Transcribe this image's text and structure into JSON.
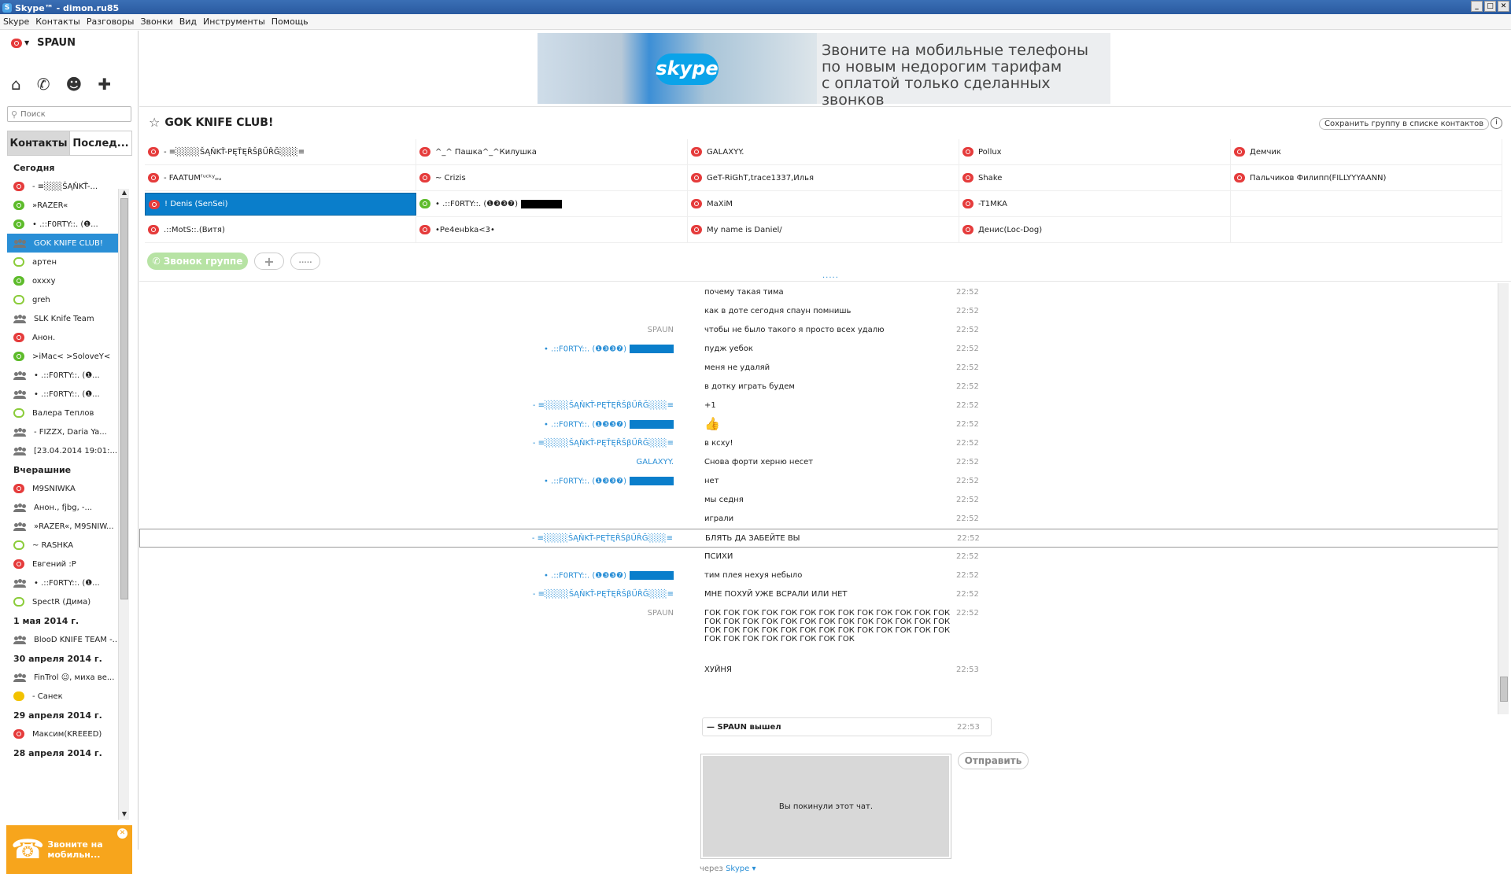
{
  "window": {
    "title": "Skype™ - dimon.ru85"
  },
  "menu": [
    "Skype",
    "Контакты",
    "Разговоры",
    "Звонки",
    "Вид",
    "Инструменты",
    "Помощь"
  ],
  "profile": {
    "name": "SPAUN"
  },
  "search": {
    "placeholder": "Поиск"
  },
  "tabs": [
    "Контакты",
    "Послед..."
  ],
  "recent": [
    {
      "type": "section",
      "label": "Сегодня"
    },
    {
      "type": "item",
      "label": "-        ≡░░░ŠĄŇKŤ-...",
      "status": "red"
    },
    {
      "type": "item",
      "label": "»RAZER«",
      "status": "green"
    },
    {
      "type": "item",
      "label": "• .::F0RTY::.  (❶...",
      "status": "green"
    },
    {
      "type": "item",
      "label": "GOK KNIFE CLUB!",
      "status": "grp",
      "selected": true
    },
    {
      "type": "item",
      "label": "артен",
      "status": "ring"
    },
    {
      "type": "item",
      "label": "oxxxy",
      "status": "green"
    },
    {
      "type": "item",
      "label": "greh",
      "status": "ring"
    },
    {
      "type": "item",
      "label": "SLK Knife Team",
      "status": "grp"
    },
    {
      "type": "item",
      "label": "Анон.",
      "status": "red"
    },
    {
      "type": "item",
      "label": ">iMac< >SoloveY<",
      "status": "green"
    },
    {
      "type": "item",
      "label": "• .::F0RTY::.  (❶...",
      "status": "grp"
    },
    {
      "type": "item",
      "label": "• .::F0RTY::.  (❶...",
      "status": "grp"
    },
    {
      "type": "item",
      "label": "Валера Теплов",
      "status": "ring"
    },
    {
      "type": "item",
      "label": "-    FIZZX, Daria Ya...",
      "status": "grp"
    },
    {
      "type": "item",
      "label": "[23.04.2014 19:01:...",
      "status": "grp"
    },
    {
      "type": "section",
      "label": "Вчерашние"
    },
    {
      "type": "item",
      "label": "M9SNIWKA",
      "status": "red"
    },
    {
      "type": "item",
      "label": "Анон., fjbg, -...",
      "status": "grp"
    },
    {
      "type": "item",
      "label": "»RAZER«, M9SNIW...",
      "status": "grp"
    },
    {
      "type": "item",
      "label": "~    RASHKA",
      "status": "ring"
    },
    {
      "type": "item",
      "label": "Евгений :P",
      "status": "red"
    },
    {
      "type": "item",
      "label": "• .::F0RTY::.  (❶...",
      "status": "grp"
    },
    {
      "type": "item",
      "label": "SpectR (Дима)",
      "status": "ring"
    },
    {
      "type": "section",
      "label": "1 мая 2014 г."
    },
    {
      "type": "item",
      "label": "BlooD KNIFE TEAM -...",
      "status": "grp"
    },
    {
      "type": "section",
      "label": "30 апреля 2014 г."
    },
    {
      "type": "item",
      "label": "FinTrol ☺, миха ве...",
      "status": "grp"
    },
    {
      "type": "item",
      "label": "-        Санек",
      "status": "yel"
    },
    {
      "type": "section",
      "label": "29 апреля 2014 г."
    },
    {
      "type": "item",
      "label": "Максим(KREEED)",
      "status": "red"
    },
    {
      "type": "section",
      "label": "28 апреля 2014 г."
    }
  ],
  "promo": {
    "text": "Звоните на мобильн..."
  },
  "banner": {
    "logo": "skype",
    "lines": [
      "Звоните на мобильные телефоны",
      "по новым недорогим тарифам",
      "с оплатой только сделанных звонков"
    ]
  },
  "chat": {
    "title": "GOK KNIFE CLUB!",
    "save_label": "Сохранить группу в списке контактов",
    "info": "i"
  },
  "members": [
    {
      "label": "-        ≡░░░░ŠĄŇKŤ-PĘŤĘŘŠβŰŘĞ░░░≡",
      "status": "red"
    },
    {
      "label": "^_^    Пашка^_^Килушка",
      "status": "red"
    },
    {
      "label": "GALAXYY.",
      "status": "red"
    },
    {
      "label": "Pollux",
      "status": "red"
    },
    {
      "label": "Демчик",
      "status": "red"
    },
    {
      "label": "-        FAATUMᶠᶸᶜᵏʸₒᵤ",
      "status": "red"
    },
    {
      "label": "~    Crizis",
      "status": "red"
    },
    {
      "label": "GeT-RiGhT,trace1337,Илья",
      "status": "red"
    },
    {
      "label": "Shake",
      "status": "red"
    },
    {
      "label": "Пальчиков Филипп(FILLYYYAANN)",
      "status": "red"
    },
    {
      "label": "! Denis (SenSei)",
      "status": "red",
      "selected": true
    },
    {
      "label": "• .::F0RTY::.  (❶❸❸❼)",
      "status": "green",
      "redacted": true
    },
    {
      "label": "MaXiM",
      "status": "red"
    },
    {
      "label": "-T1MKA",
      "status": "red"
    },
    {
      "label": "",
      "status": "none"
    },
    {
      "label": ".::MotS::.(Витя)",
      "status": "red"
    },
    {
      "label": "•Ре4енbka<3•",
      "status": "red"
    },
    {
      "label": "My name is Daniel/",
      "status": "red"
    },
    {
      "label": "Денис(Loc-Dog)",
      "status": "red"
    },
    {
      "label": "",
      "status": "none"
    }
  ],
  "call": {
    "group_call": "Звонок группе",
    "add": "+",
    "signal": "....."
  },
  "messages": [
    {
      "sender": "",
      "text": "почему такая тима",
      "time": "22:52"
    },
    {
      "sender": "",
      "text": "как в доте сегодня спаун помнишь",
      "time": "22:52"
    },
    {
      "sender": "SPAUN",
      "me": true,
      "text": "чтобы не было такого я просто всех удалю",
      "time": "22:52"
    },
    {
      "sender": "• .::F0RTY::.  (❶❸❸❼)",
      "box": true,
      "text": "пудж уебок",
      "time": "22:52"
    },
    {
      "sender": "",
      "text": "меня не удаляй",
      "time": "22:52"
    },
    {
      "sender": "",
      "text": "в дотку играть будем",
      "time": "22:52"
    },
    {
      "sender": "-        ≡░░░░ŠĄŇKŤ-PĘŤĘŘŠβŰŘĞ░░░≡",
      "text": "+1",
      "time": "22:52"
    },
    {
      "sender": "• .::F0RTY::.  (❶❸❸❼)",
      "box": true,
      "text": "👍",
      "time": "22:52"
    },
    {
      "sender": "-        ≡░░░░ŠĄŇKŤ-PĘŤĘŘŠβŰŘĞ░░░≡",
      "text": "в ксху!",
      "time": "22:52"
    },
    {
      "sender": "GALAXYY.",
      "text": "Снова форти херню несет",
      "time": "22:52"
    },
    {
      "sender": "• .::F0RTY::.  (❶❸❸❼)",
      "box": true,
      "text": "нет",
      "time": "22:52"
    },
    {
      "sender": "",
      "text": "мы седня",
      "time": "22:52"
    },
    {
      "sender": "",
      "text": "играли",
      "time": "22:52"
    },
    {
      "sender": "-        ≡░░░░ŠĄŇKŤ-PĘŤĘŘŠβŰŘĞ░░░≡",
      "text": "БЛЯТЬ ДА ЗАБЕЙТЕ ВЫ",
      "time": "22:52",
      "highlight": true
    },
    {
      "sender": "",
      "text": "ПСИХИ",
      "time": "22:52"
    },
    {
      "sender": "• .::F0RTY::.  (❶❸❸❼)",
      "box": true,
      "text": "тим плея нехуя небыло",
      "time": "22:52"
    },
    {
      "sender": "-        ≡░░░░ŠĄŇKŤ-PĘŤĘŘŠβŰŘĞ░░░≡",
      "text": "МНЕ ПОХУЙ УЖЕ ВСРАЛИ ИЛИ НЕТ",
      "time": "22:52"
    },
    {
      "sender": "SPAUN",
      "me": true,
      "text": "ГОК ГОК ГОК ГОК ГОК ГОК ГОК ГОК ГОК ГОК ГОК ГОК ГОК\nГОК ГОК ГОК ГОК ГОК ГОК ГОК ГОК ГОК ГОК ГОК ГОК ГОК\nГОК ГОК ГОК ГОК ГОК ГОК ГОК ГОК ГОК ГОК ГОК ГОК ГОК\nГОК ГОК ГОК ГОК ГОК ГОК ГОК ГОК",
      "time": "22:52",
      "multi": true
    },
    {
      "sender": "",
      "text": "ХУЙНЯ",
      "time": "22:53"
    }
  ],
  "left_event": {
    "text": "— SPAUN вышел",
    "time": "22:53"
  },
  "input": {
    "left_text": "Вы покинули этот чат.",
    "send_label": "Отправить"
  },
  "via": {
    "prefix": "через",
    "link": "Skype ▾"
  }
}
